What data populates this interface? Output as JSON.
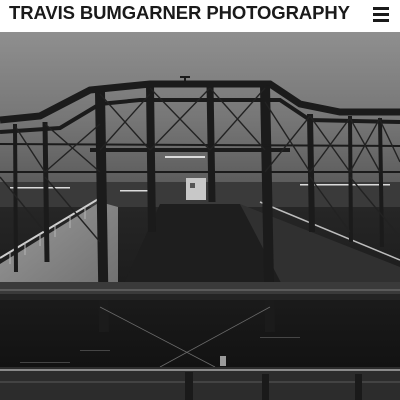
{
  "header": {
    "site_title": "TRAVIS BUMGARNER PHOTOGRAPHY",
    "menu_icon": "hamburger-menu-icon"
  },
  "hero": {
    "subject": "bridge-photograph",
    "palette": {
      "sky_top": "#8a8a8a",
      "sky_bottom": "#6a6a6a",
      "steel": "#1c1c1c",
      "water": "#141414",
      "deck": "#8c8c8c"
    }
  }
}
